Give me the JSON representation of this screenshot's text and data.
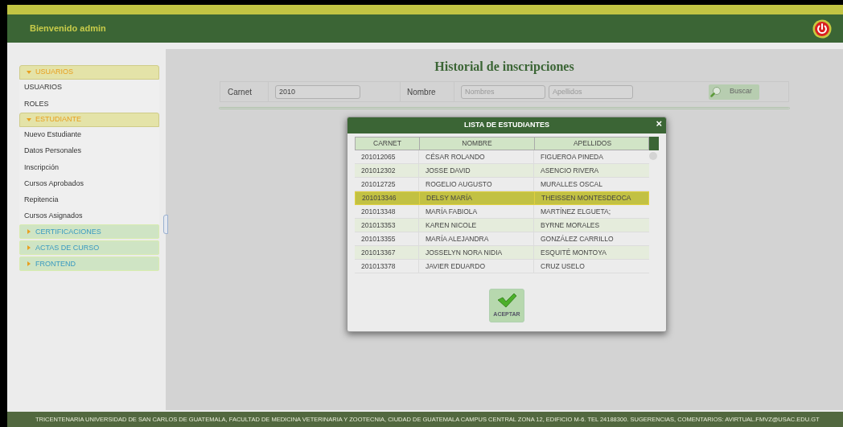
{
  "header": {
    "welcome": "Bienvenido admin"
  },
  "sidebar": {
    "sections": [
      {
        "label": "USUARIOS",
        "expanded": true,
        "items": [
          "USUARIOS",
          "ROLES"
        ]
      },
      {
        "label": "ESTUDIANTE",
        "expanded": true,
        "items": [
          "Nuevo Estudiante",
          "Datos Personales",
          "Inscripción",
          "Cursos Aprobados",
          "Repitencia",
          "Cursos Asignados"
        ]
      },
      {
        "label": "CERTIFICACIONES",
        "expanded": false
      },
      {
        "label": "ACTAS DE CURSO",
        "expanded": false
      },
      {
        "label": "FRONTEND",
        "expanded": false
      }
    ]
  },
  "content": {
    "title": "Historial de inscripciones",
    "search": {
      "carnet_label": "Carnet",
      "carnet_value": "2010",
      "nombre_label": "Nombre",
      "nombres_placeholder": "Nombres",
      "apellidos_placeholder": "Apellidos",
      "button": "Buscar"
    }
  },
  "dialog": {
    "title": "LISTA DE ESTUDIANTES",
    "close": "×",
    "columns": [
      "CARNET",
      "NOMBRE",
      "APELLIDOS"
    ],
    "rows": [
      {
        "cells": [
          "201012065",
          "CÉSAR ROLANDO",
          "FIGUEROA PINEDA"
        ],
        "selected": false
      },
      {
        "cells": [
          "201012302",
          "JOSSE DAVID",
          "ASENCIO RIVERA"
        ],
        "selected": false
      },
      {
        "cells": [
          "201012725",
          "ROGELIO AUGUSTO",
          "MURALLES OSCAL"
        ],
        "selected": false
      },
      {
        "cells": [
          "201013346",
          "DELSY MARÍA",
          "THEISSEN MONTESDEOCA"
        ],
        "selected": true
      },
      {
        "cells": [
          "201013348",
          "MARÍA FABIOLA",
          "MARTÍNEZ ELGUETA;"
        ],
        "selected": false
      },
      {
        "cells": [
          "201013353",
          "KAREN NICOLE",
          "BYRNE MORALES"
        ],
        "selected": false
      },
      {
        "cells": [
          "201013355",
          "MARÍA ALEJANDRA",
          "GONZÁLEZ CARRILLO"
        ],
        "selected": false
      },
      {
        "cells": [
          "201013367",
          "JOSSELYN NORA NIDIA",
          "ESQUITÉ MONTOYA"
        ],
        "selected": false
      },
      {
        "cells": [
          "201013378",
          "JAVIER EDUARDO",
          "CRUZ USELO"
        ],
        "selected": false
      }
    ],
    "button": "ACEPTAR"
  },
  "footer": "TRICENTENARIA UNIVERSIDAD DE SAN CARLOS DE GUATEMALA, FACULTAD DE MEDICINA VETERINARIA Y ZOOTECNIA, CIUDAD DE GUATEMALA CAMPUS CENTRAL ZONA 12, EDIFICIO M-6. TEL 24188300. SUGERENCIAS, COMENTARIOS: AVIRTUAL.FMVZ@USAC.EDU.GT"
}
